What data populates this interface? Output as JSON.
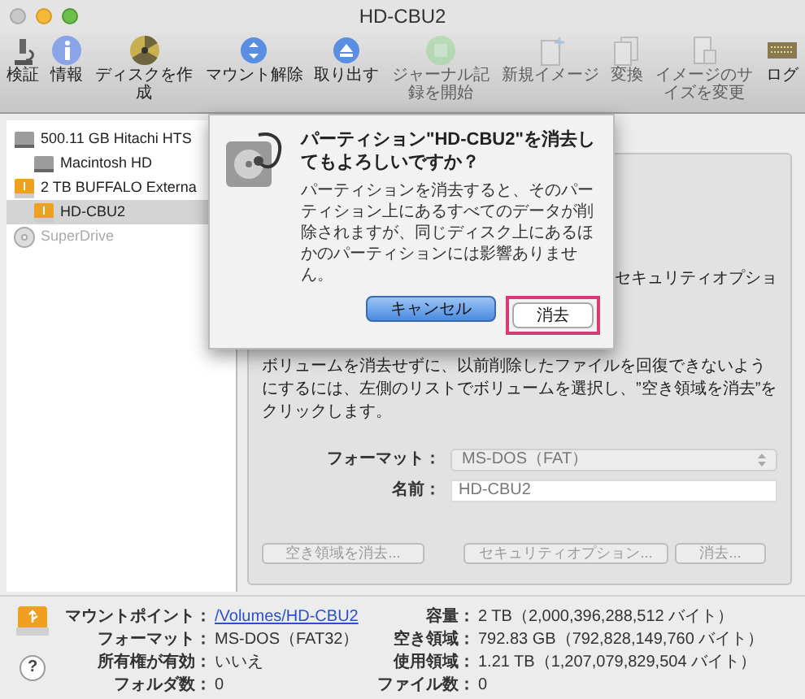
{
  "window": {
    "title": "HD-CBU2"
  },
  "toolbar": [
    {
      "label": "検証",
      "disabled": false
    },
    {
      "label": "情報",
      "disabled": false
    },
    {
      "label": "ディスクを作成",
      "disabled": false
    },
    {
      "label": "マウント解除",
      "disabled": false
    },
    {
      "label": "取り出す",
      "disabled": false
    },
    {
      "label": "ジャーナル記録を開始",
      "disabled": true
    },
    {
      "label": "新規イメージ",
      "disabled": true
    },
    {
      "label": "変換",
      "disabled": true
    },
    {
      "label": "イメージのサイズを変更",
      "disabled": true
    },
    {
      "label": "ログ",
      "disabled": false
    }
  ],
  "sidebar": {
    "items": [
      {
        "label": "500.11 GB Hitachi HTS",
        "kind": "internal",
        "selected": false,
        "disabled": false,
        "children": [
          {
            "label": "Macintosh HD",
            "kind": "internal",
            "selected": false,
            "disabled": false
          }
        ]
      },
      {
        "label": "2 TB BUFFALO Externa",
        "kind": "external",
        "selected": false,
        "disabled": false,
        "children": [
          {
            "label": "HD-CBU2",
            "kind": "external",
            "selected": true,
            "disabled": false
          }
        ]
      },
      {
        "label": "SuperDrive",
        "kind": "optical",
        "selected": false,
        "disabled": true
      }
    ]
  },
  "dialog": {
    "title": "パーティション\"HD-CBU2\"を消去してもよろしいですか？",
    "message": "パーティションを消去すると、そのパーティション上にあるすべてのデータが削除されますが、同じディスク上にあるほかのパーティションには影響ありません。",
    "buttons": [
      {
        "label": "キャンセル",
        "kind": "default",
        "highlighted": false
      },
      {
        "label": "消去",
        "kind": "normal",
        "highlighted": true
      }
    ]
  },
  "erase_panel": {
    "partial_text": "セキュリティオプショ",
    "description": "ボリュームを消去せずに、以前削除したファイルを回復できないようにするには、左側のリストでボリュームを選択し、”空き領域を消去”をクリックします。",
    "format": {
      "label": "フォーマット：",
      "value": "MS-DOS（FAT）"
    },
    "name": {
      "label": "名前：",
      "value": "HD-CBU2"
    },
    "buttons": [
      {
        "label": "空き領域を消去...",
        "disabled": true
      },
      {
        "label": "セキュリティオプション...",
        "disabled": true
      },
      {
        "label": "消去...",
        "disabled": true
      }
    ]
  },
  "info": {
    "left": [
      {
        "label": "マウントポイント：",
        "value": "/Volumes/HD-CBU2",
        "kind": "link"
      },
      {
        "label": "フォーマット：",
        "value": "MS-DOS（FAT32）",
        "kind": "text"
      },
      {
        "label": "所有権が有効：",
        "value": "いいえ",
        "kind": "text"
      },
      {
        "label": "フォルダ数：",
        "value": "0",
        "kind": "text"
      }
    ],
    "right": [
      {
        "label": "容量：",
        "value": "2 TB（2,000,396,288,512 バイト）",
        "kind": "text"
      },
      {
        "label": "空き領域：",
        "value": "792.83 GB（792,828,149,760 バイト）",
        "kind": "text"
      },
      {
        "label": "使用領域：",
        "value": "1.21 TB（1,207,079,829,504 バイト）",
        "kind": "text"
      },
      {
        "label": "ファイル数：",
        "value": "0",
        "kind": "text"
      }
    ]
  },
  "help_button": {
    "label": "?"
  }
}
